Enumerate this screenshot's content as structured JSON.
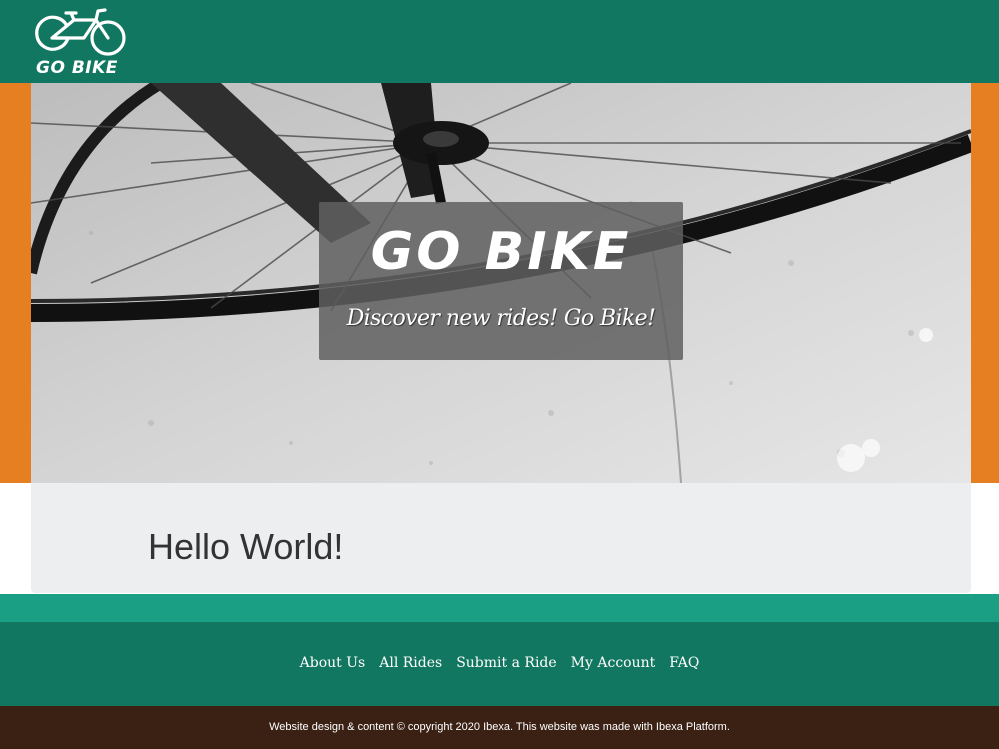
{
  "brand": {
    "name": "GO BIKE"
  },
  "hero": {
    "title": "GO BIKE",
    "subtitle": "Discover new rides! Go Bike!"
  },
  "main": {
    "heading": "Hello World!"
  },
  "footer": {
    "nav": [
      {
        "label": "About Us"
      },
      {
        "label": "All Rides"
      },
      {
        "label": "Submit a Ride"
      },
      {
        "label": "My Account"
      },
      {
        "label": "FAQ"
      }
    ],
    "copyright": "Website design & content © copyright 2020 Ibexa. This website was made with Ibexa Platform."
  },
  "colors": {
    "header": "#127760",
    "accent": "#e67e22",
    "strip": "#1a9e84",
    "bottom": "#3a2114"
  }
}
